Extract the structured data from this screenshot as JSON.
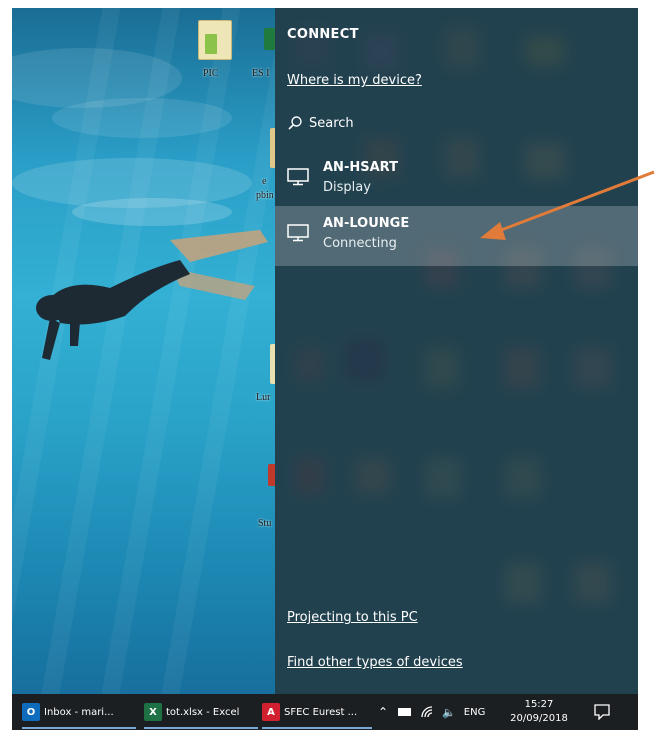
{
  "desktop": {
    "icons": [
      {
        "label": "PIC",
        "icon": "file-icon",
        "color": "#e8d98a"
      },
      {
        "label": "ES I",
        "icon": "excel-file-icon",
        "color": "#1f7a3d"
      },
      {
        "label": "e",
        "icon": "file-icon",
        "color": "#e0c88a"
      },
      {
        "label": "pbin",
        "icon": "file-icon",
        "color": "#e0c88a"
      },
      {
        "label": "Lur",
        "icon": "file-icon",
        "color": "#e8e0b0"
      },
      {
        "label": "Stu",
        "icon": "file-icon",
        "color": "#c0392b"
      }
    ]
  },
  "connect_panel": {
    "title": "CONNECT",
    "where_link": "Where is my device?",
    "search_label": "Search",
    "devices": [
      {
        "name": "AN-HSART",
        "status": "Display",
        "icon": "monitor-icon",
        "selected": false
      },
      {
        "name": "AN-LOUNGE",
        "status": "Connecting",
        "icon": "monitor-icon",
        "selected": true
      }
    ],
    "projecting_link": "Projecting to this PC",
    "find_link": "Find other types of devices",
    "background_color": "#1b3642"
  },
  "annotation": {
    "arrow_color": "#e07b39"
  },
  "taskbar": {
    "apps": [
      {
        "label": "Inbox - mari...",
        "icon": "outlook-icon",
        "badge": "O",
        "color": "#0f6cbd"
      },
      {
        "label": "tot.xlsx - Excel",
        "icon": "excel-icon",
        "badge": "X",
        "color": "#1e7145"
      },
      {
        "label": "SFEC Eurest ...",
        "icon": "acrobat-icon",
        "badge": "A",
        "color": "#d1202f"
      }
    ],
    "tray": {
      "language": "ENG",
      "time": "15:27",
      "date": "20/09/2018"
    }
  }
}
